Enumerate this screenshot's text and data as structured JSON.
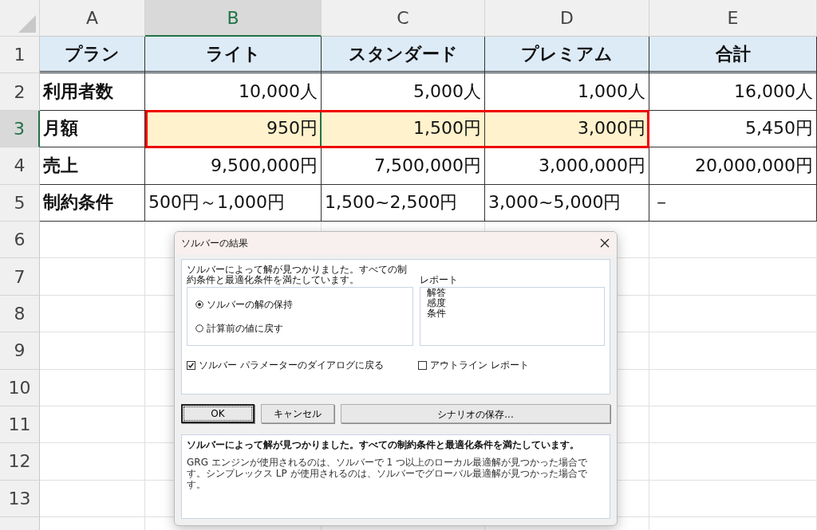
{
  "spreadsheet": {
    "columns": [
      {
        "label": "A",
        "selected": false
      },
      {
        "label": "B",
        "selected": true
      },
      {
        "label": "C",
        "selected": false
      },
      {
        "label": "D",
        "selected": false
      },
      {
        "label": "E",
        "selected": false
      }
    ],
    "rows": [
      {
        "number": "1",
        "selected": false,
        "kind": "header",
        "cells": [
          {
            "text": "プラン",
            "highlighted": false
          },
          {
            "text": "ライト",
            "highlighted": false
          },
          {
            "text": "スタンダード",
            "highlighted": false
          },
          {
            "text": "プレミアム",
            "highlighted": false
          },
          {
            "text": "合計",
            "highlighted": false
          }
        ]
      },
      {
        "number": "2",
        "selected": false,
        "kind": "number",
        "cells": [
          {
            "text": "利用者数",
            "highlighted": false
          },
          {
            "text": "10,000人",
            "highlighted": false
          },
          {
            "text": "5,000人",
            "highlighted": false
          },
          {
            "text": "1,000人",
            "highlighted": false
          },
          {
            "text": "16,000人",
            "highlighted": false
          }
        ]
      },
      {
        "number": "3",
        "selected": true,
        "kind": "number",
        "cells": [
          {
            "text": "月額",
            "highlighted": false
          },
          {
            "text": "950円",
            "highlighted": true
          },
          {
            "text": "1,500円",
            "highlighted": true
          },
          {
            "text": "3,000円",
            "highlighted": true
          },
          {
            "text": "5,450円",
            "highlighted": false
          }
        ]
      },
      {
        "number": "4",
        "selected": false,
        "kind": "number",
        "cells": [
          {
            "text": "売上",
            "highlighted": false
          },
          {
            "text": "9,500,000円",
            "highlighted": false
          },
          {
            "text": "7,500,000円",
            "highlighted": false
          },
          {
            "text": "3,000,000円",
            "highlighted": false
          },
          {
            "text": "20,000,000円",
            "highlighted": false
          }
        ]
      },
      {
        "number": "5",
        "selected": false,
        "kind": "text",
        "cells": [
          {
            "text": "制約条件",
            "highlighted": false
          },
          {
            "text": "500円～1,000円",
            "highlighted": false
          },
          {
            "text": "1,500~2,500円",
            "highlighted": false
          },
          {
            "text": "3,000~5,000円",
            "highlighted": false
          },
          {
            "text": "－",
            "highlighted": false
          }
        ]
      },
      {
        "number": "6",
        "selected": false
      },
      {
        "number": "7",
        "selected": false
      },
      {
        "number": "8",
        "selected": false
      },
      {
        "number": "9",
        "selected": false
      },
      {
        "number": "10",
        "selected": false
      },
      {
        "number": "11",
        "selected": false
      },
      {
        "number": "12",
        "selected": false
      },
      {
        "number": "13",
        "selected": false
      },
      {
        "selected": false
      }
    ]
  },
  "dialog": {
    "title": "ソルバーの結果",
    "message": "ソルバーによって解が見つかりました。すべての制約条件と最適化条件を満たしています。",
    "options": [
      {
        "label": "ソルバーの解の保持",
        "selected": true
      },
      {
        "label": "計算前の値に戻す",
        "selected": false
      }
    ],
    "report_label": "レポート",
    "reports": [
      "解答",
      "感度",
      "条件"
    ],
    "checkboxes": [
      {
        "label": "ソルバー パラメーターのダイアログに戻る",
        "checked": true
      },
      {
        "label": "アウトライン レポート",
        "checked": false
      }
    ],
    "buttons": [
      {
        "label": "OK",
        "kind": "default"
      },
      {
        "label": "キャンセル",
        "kind": "normal"
      },
      {
        "label": "シナリオの保存...",
        "kind": "right"
      }
    ],
    "summary_title": "ソルバーによって解が見つかりました。すべての制約条件と最適化条件を満たしています。",
    "summary_text": "GRG エンジンが使用されるのは、ソルバーで 1 つ以上のローカル最適解が見つかった場合です。シンプレックス LP が使用されるのは、ソルバーでグローバル最適解が見つかった場合です。"
  }
}
